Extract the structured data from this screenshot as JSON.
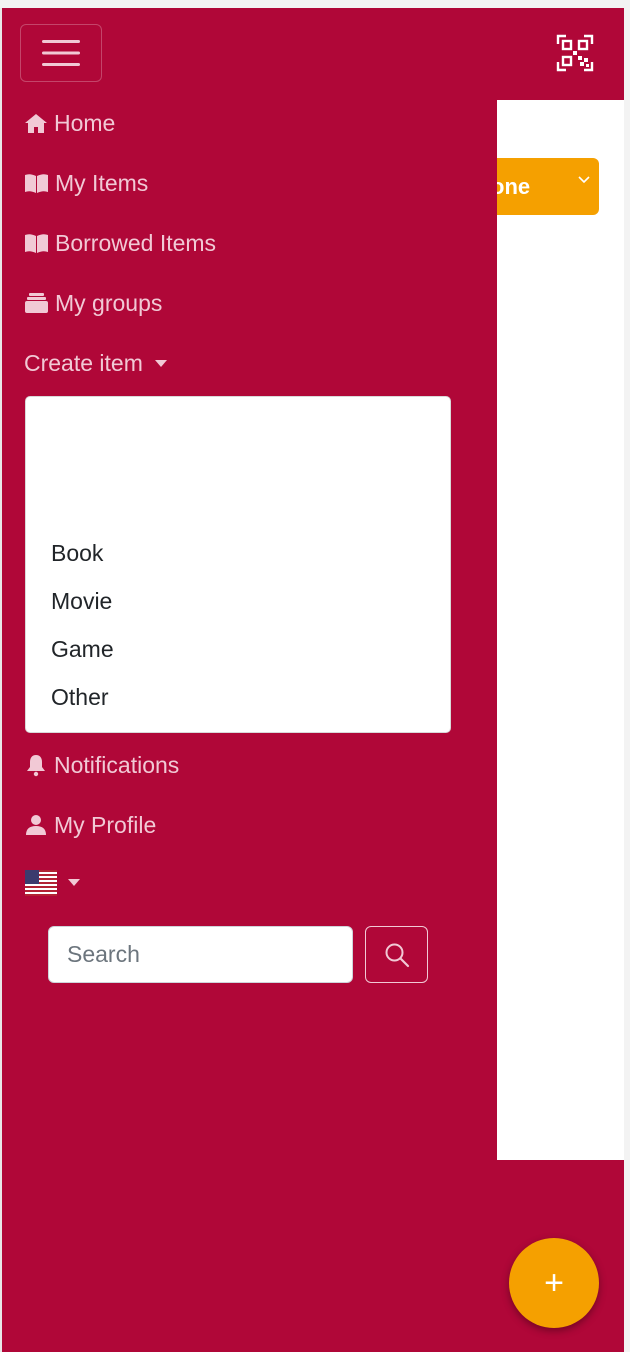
{
  "navbar": {
    "toggle_icon": "hamburger-icon",
    "qr_icon": "qr-code-icon"
  },
  "content": {
    "dropdown_label": "one"
  },
  "sidebar": {
    "items": [
      {
        "label": "Home",
        "icon": "home-icon"
      },
      {
        "label": "My Items",
        "icon": "book-open-icon"
      },
      {
        "label": "Borrowed Items",
        "icon": "book-open-icon"
      },
      {
        "label": "My groups",
        "icon": "layers-icon"
      }
    ],
    "create_item": {
      "label": "Create item",
      "options": [
        "Book",
        "Movie",
        "Game",
        "Other"
      ]
    },
    "after_items": [
      {
        "label": "Notifications",
        "icon": "bell-icon"
      },
      {
        "label": "My Profile",
        "icon": "user-icon"
      }
    ],
    "language_icon": "us-flag-icon",
    "search": {
      "placeholder": "Search",
      "button_icon": "search-icon"
    }
  },
  "fab": {
    "label": "+"
  },
  "colors": {
    "brand": "#b00738",
    "accent": "#f5a000",
    "nav_text": "#f1c9d5"
  }
}
